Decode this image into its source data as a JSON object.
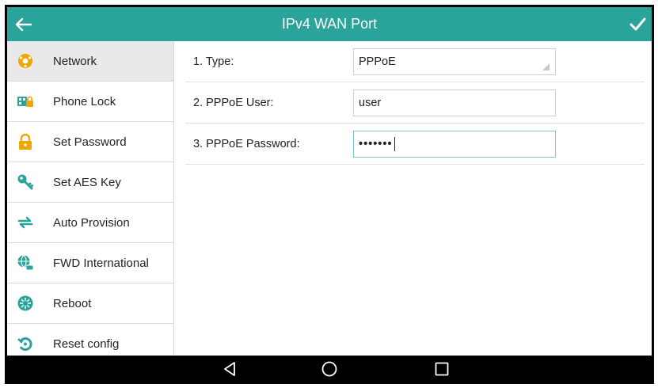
{
  "title": "IPv4 WAN Port",
  "sidebar": {
    "items": [
      {
        "label": "Network",
        "icon": "network-icon",
        "active": true
      },
      {
        "label": "Phone Lock",
        "icon": "phone-lock-icon"
      },
      {
        "label": "Set Password",
        "icon": "lock-icon"
      },
      {
        "label": "Set AES Key",
        "icon": "key-icon"
      },
      {
        "label": "Auto Provision",
        "icon": "sync-icon"
      },
      {
        "label": "FWD International",
        "icon": "globe-phone-icon"
      },
      {
        "label": "Reboot",
        "icon": "reboot-icon"
      },
      {
        "label": "Reset config",
        "icon": "reset-icon"
      }
    ]
  },
  "form": {
    "rows": [
      {
        "label": "1. Type:",
        "value": "PPPoE",
        "kind": "dropdown"
      },
      {
        "label": "2. PPPoE User:",
        "value": "user",
        "kind": "text"
      },
      {
        "label": "3. PPPoE Password:",
        "value": "•••••••",
        "kind": "password"
      }
    ]
  },
  "colors": {
    "accent": "#2aa39a",
    "icon_orange": "#f0a500",
    "icon_teal": "#2aa39a"
  }
}
